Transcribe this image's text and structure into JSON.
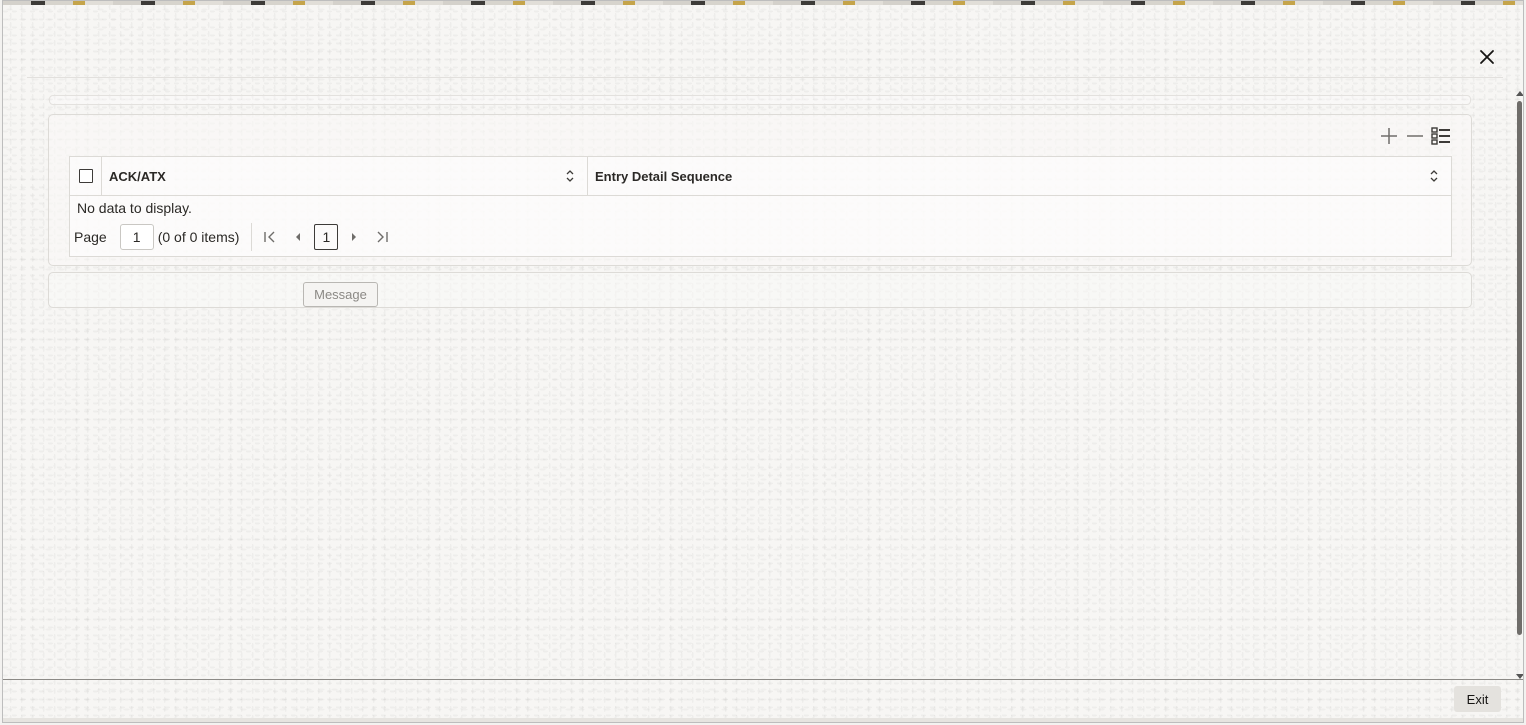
{
  "grid": {
    "columns": [
      {
        "label": "ACK/ATX"
      },
      {
        "label": "Entry Detail Sequence"
      }
    ],
    "empty_text": "No data to display.",
    "pager": {
      "page_label": "Page",
      "page_value": "1",
      "items_text": "(0 of 0 items)",
      "current_page": "1"
    }
  },
  "message_button": "Message",
  "exit_button": "Exit",
  "icons": {
    "close": "close-icon",
    "add": "plus-icon",
    "delete": "minus-icon",
    "columns": "list-settings-icon",
    "sort": "sort-icon"
  },
  "colors": {
    "text": "#161513",
    "border": "#dcdad6",
    "disabled_text": "#8b8985"
  }
}
